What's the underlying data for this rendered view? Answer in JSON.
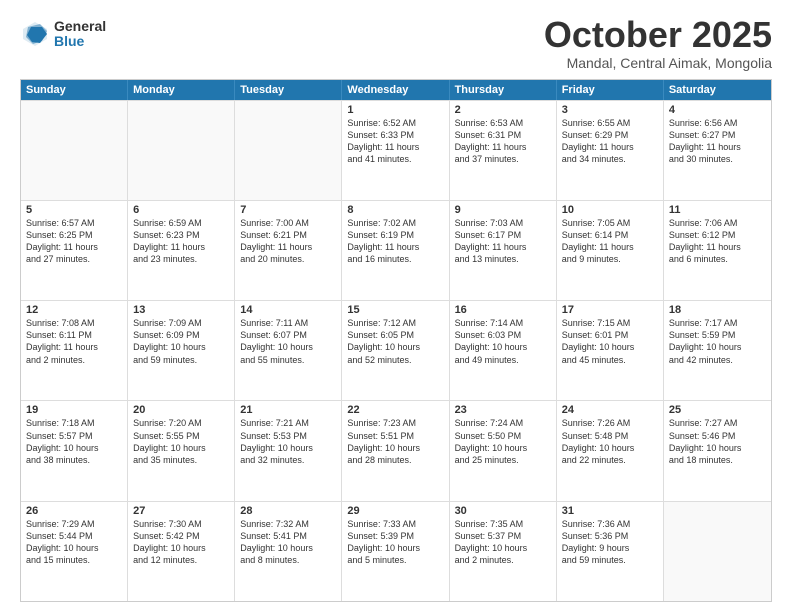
{
  "logo": {
    "general": "General",
    "blue": "Blue"
  },
  "title": "October 2025",
  "subtitle": "Mandal, Central Aimak, Mongolia",
  "header_days": [
    "Sunday",
    "Monday",
    "Tuesday",
    "Wednesday",
    "Thursday",
    "Friday",
    "Saturday"
  ],
  "weeks": [
    [
      {
        "day": "",
        "text": ""
      },
      {
        "day": "",
        "text": ""
      },
      {
        "day": "",
        "text": ""
      },
      {
        "day": "1",
        "text": "Sunrise: 6:52 AM\nSunset: 6:33 PM\nDaylight: 11 hours\nand 41 minutes."
      },
      {
        "day": "2",
        "text": "Sunrise: 6:53 AM\nSunset: 6:31 PM\nDaylight: 11 hours\nand 37 minutes."
      },
      {
        "day": "3",
        "text": "Sunrise: 6:55 AM\nSunset: 6:29 PM\nDaylight: 11 hours\nand 34 minutes."
      },
      {
        "day": "4",
        "text": "Sunrise: 6:56 AM\nSunset: 6:27 PM\nDaylight: 11 hours\nand 30 minutes."
      }
    ],
    [
      {
        "day": "5",
        "text": "Sunrise: 6:57 AM\nSunset: 6:25 PM\nDaylight: 11 hours\nand 27 minutes."
      },
      {
        "day": "6",
        "text": "Sunrise: 6:59 AM\nSunset: 6:23 PM\nDaylight: 11 hours\nand 23 minutes."
      },
      {
        "day": "7",
        "text": "Sunrise: 7:00 AM\nSunset: 6:21 PM\nDaylight: 11 hours\nand 20 minutes."
      },
      {
        "day": "8",
        "text": "Sunrise: 7:02 AM\nSunset: 6:19 PM\nDaylight: 11 hours\nand 16 minutes."
      },
      {
        "day": "9",
        "text": "Sunrise: 7:03 AM\nSunset: 6:17 PM\nDaylight: 11 hours\nand 13 minutes."
      },
      {
        "day": "10",
        "text": "Sunrise: 7:05 AM\nSunset: 6:14 PM\nDaylight: 11 hours\nand 9 minutes."
      },
      {
        "day": "11",
        "text": "Sunrise: 7:06 AM\nSunset: 6:12 PM\nDaylight: 11 hours\nand 6 minutes."
      }
    ],
    [
      {
        "day": "12",
        "text": "Sunrise: 7:08 AM\nSunset: 6:11 PM\nDaylight: 11 hours\nand 2 minutes."
      },
      {
        "day": "13",
        "text": "Sunrise: 7:09 AM\nSunset: 6:09 PM\nDaylight: 10 hours\nand 59 minutes."
      },
      {
        "day": "14",
        "text": "Sunrise: 7:11 AM\nSunset: 6:07 PM\nDaylight: 10 hours\nand 55 minutes."
      },
      {
        "day": "15",
        "text": "Sunrise: 7:12 AM\nSunset: 6:05 PM\nDaylight: 10 hours\nand 52 minutes."
      },
      {
        "day": "16",
        "text": "Sunrise: 7:14 AM\nSunset: 6:03 PM\nDaylight: 10 hours\nand 49 minutes."
      },
      {
        "day": "17",
        "text": "Sunrise: 7:15 AM\nSunset: 6:01 PM\nDaylight: 10 hours\nand 45 minutes."
      },
      {
        "day": "18",
        "text": "Sunrise: 7:17 AM\nSunset: 5:59 PM\nDaylight: 10 hours\nand 42 minutes."
      }
    ],
    [
      {
        "day": "19",
        "text": "Sunrise: 7:18 AM\nSunset: 5:57 PM\nDaylight: 10 hours\nand 38 minutes."
      },
      {
        "day": "20",
        "text": "Sunrise: 7:20 AM\nSunset: 5:55 PM\nDaylight: 10 hours\nand 35 minutes."
      },
      {
        "day": "21",
        "text": "Sunrise: 7:21 AM\nSunset: 5:53 PM\nDaylight: 10 hours\nand 32 minutes."
      },
      {
        "day": "22",
        "text": "Sunrise: 7:23 AM\nSunset: 5:51 PM\nDaylight: 10 hours\nand 28 minutes."
      },
      {
        "day": "23",
        "text": "Sunrise: 7:24 AM\nSunset: 5:50 PM\nDaylight: 10 hours\nand 25 minutes."
      },
      {
        "day": "24",
        "text": "Sunrise: 7:26 AM\nSunset: 5:48 PM\nDaylight: 10 hours\nand 22 minutes."
      },
      {
        "day": "25",
        "text": "Sunrise: 7:27 AM\nSunset: 5:46 PM\nDaylight: 10 hours\nand 18 minutes."
      }
    ],
    [
      {
        "day": "26",
        "text": "Sunrise: 7:29 AM\nSunset: 5:44 PM\nDaylight: 10 hours\nand 15 minutes."
      },
      {
        "day": "27",
        "text": "Sunrise: 7:30 AM\nSunset: 5:42 PM\nDaylight: 10 hours\nand 12 minutes."
      },
      {
        "day": "28",
        "text": "Sunrise: 7:32 AM\nSunset: 5:41 PM\nDaylight: 10 hours\nand 8 minutes."
      },
      {
        "day": "29",
        "text": "Sunrise: 7:33 AM\nSunset: 5:39 PM\nDaylight: 10 hours\nand 5 minutes."
      },
      {
        "day": "30",
        "text": "Sunrise: 7:35 AM\nSunset: 5:37 PM\nDaylight: 10 hours\nand 2 minutes."
      },
      {
        "day": "31",
        "text": "Sunrise: 7:36 AM\nSunset: 5:36 PM\nDaylight: 9 hours\nand 59 minutes."
      },
      {
        "day": "",
        "text": ""
      }
    ]
  ]
}
